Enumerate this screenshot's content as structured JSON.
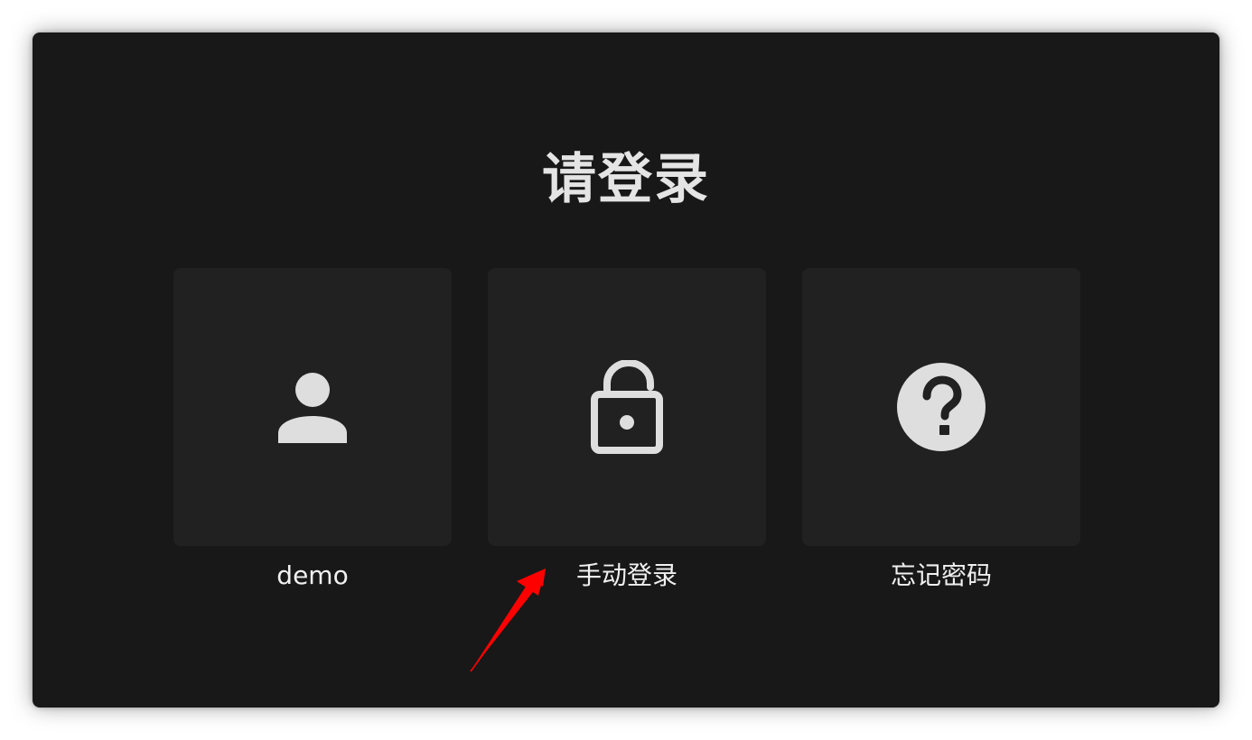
{
  "login": {
    "title": "请登录",
    "options": [
      {
        "label": "demo",
        "icon": "user-icon"
      },
      {
        "label": "手动登录",
        "icon": "unlock-icon"
      },
      {
        "label": "忘记密码",
        "icon": "help-circle-icon"
      }
    ]
  },
  "colors": {
    "window_bg": "#181818",
    "tile_bg": "#212121",
    "icon": "#dedede",
    "text": "#f0f0f0",
    "annotation_arrow": "#ff0000"
  },
  "annotation": {
    "icon": "red-arrow-icon"
  }
}
